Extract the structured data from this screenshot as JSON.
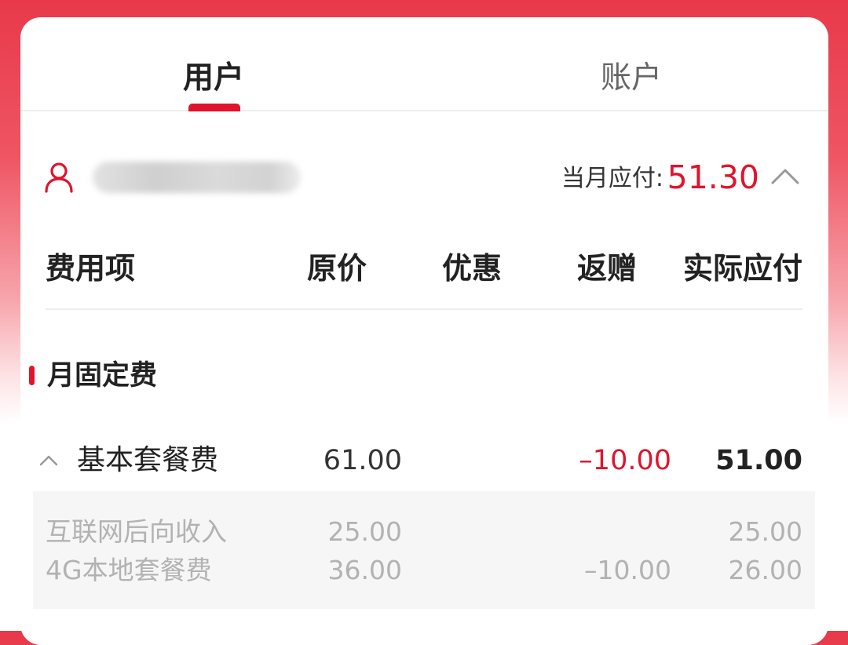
{
  "tabs": {
    "user": "用户",
    "account": "账户"
  },
  "user_summary": {
    "due_label": "当月应付:",
    "due_value": "51.30"
  },
  "table_header": {
    "item": "费用项",
    "original_price": "原价",
    "discount": "优惠",
    "rebate": "返赠",
    "actual_due": "实际应付"
  },
  "section": {
    "title": "月固定费"
  },
  "fee_item": {
    "name": "基本套餐费",
    "original_price": "61.00",
    "discount": "",
    "rebate": "–10.00",
    "actual_due": "51.00",
    "sub_items": [
      {
        "name": "互联网后向收入",
        "original_price": "25.00",
        "discount": "",
        "rebate": "",
        "actual_due": "25.00"
      },
      {
        "name": "4G本地套餐费",
        "original_price": "36.00",
        "discount": "",
        "rebate": "–10.00",
        "actual_due": "26.00"
      }
    ]
  },
  "colors": {
    "accent": "#e0142c",
    "header_gradient_top": "#e8394a",
    "muted_text": "#b2b2b2"
  },
  "icons": {
    "user": "user-icon",
    "collapse": "chevron-up-icon"
  }
}
